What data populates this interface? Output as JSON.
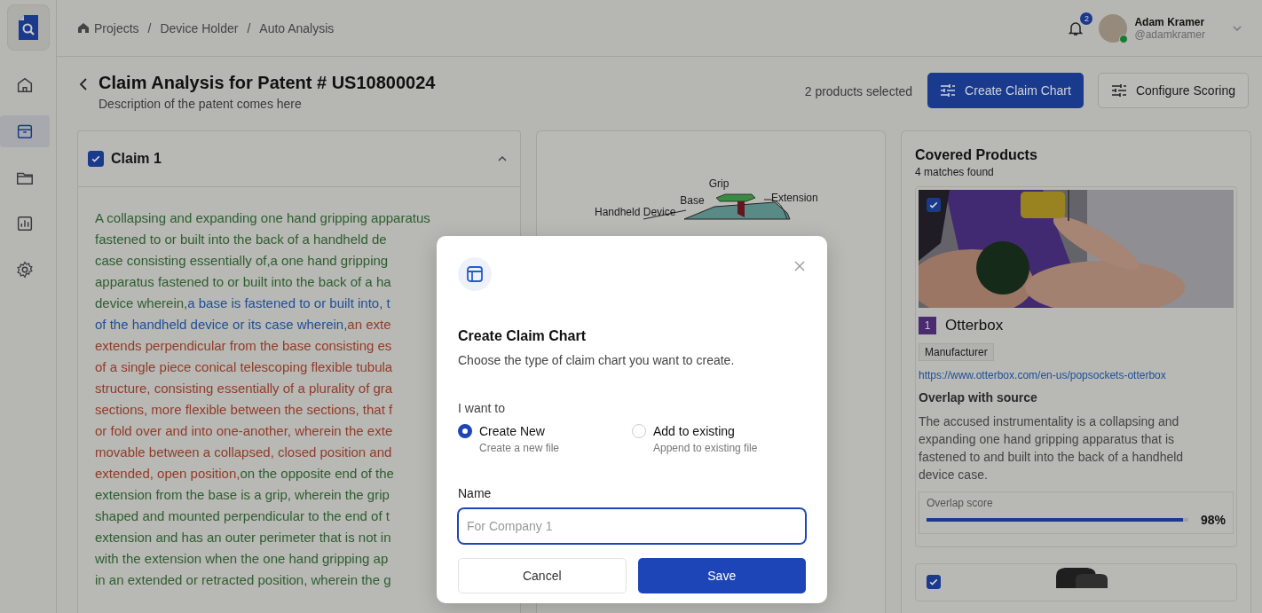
{
  "breadcrumbs": [
    {
      "label": "Projects",
      "kind": "home"
    },
    {
      "label": "Device Holder",
      "kind": "plain",
      "separator": "/"
    },
    {
      "label": "Auto Analysis",
      "kind": "plain",
      "separator": "/"
    }
  ],
  "notifications": {
    "count": "2"
  },
  "user": {
    "name": "Adam Kramer",
    "handle": "@adamkramer",
    "online": true
  },
  "sidebar": {
    "items": [
      {
        "kind": "home",
        "selected": false
      },
      {
        "kind": "archive",
        "selected": true
      },
      {
        "kind": "folder",
        "selected": false
      },
      {
        "kind": "chart",
        "selected": false
      },
      {
        "kind": "settings",
        "selected": false
      }
    ]
  },
  "page": {
    "title": "Claim Analysis for Patent # US10800024",
    "description": "Description of the patent comes here",
    "selection_count": "2 products selected",
    "buttons": [
      {
        "label": "Create Claim Chart",
        "kind": "primary"
      },
      {
        "label": "Configure Scoring",
        "kind": "secondary"
      }
    ]
  },
  "claim": {
    "title": "Claim 1",
    "checked": true,
    "expanded": true,
    "lines": [
      {
        "segments": [
          {
            "text": "A collapsing and expanding one hand gripping apparatus",
            "color": "#2d5e30"
          }
        ]
      },
      {
        "segments": [
          {
            "text": "fastened to or built into the back of a handheld de",
            "color": "#2d5e30"
          }
        ]
      },
      {
        "segments": [
          {
            "text": "case consisting essentially of,a one hand gripping",
            "color": "#2d5e30"
          }
        ]
      },
      {
        "segments": [
          {
            "text": "apparatus fastened to or built into the back of a ha",
            "color": "#2d5e30"
          }
        ]
      },
      {
        "segments": [
          {
            "text": "device wherein,",
            "color": "#2d5e30"
          },
          {
            "text": "a base is fastened to or built into, t",
            "color": "#1d4f9c"
          }
        ]
      },
      {
        "segments": [
          {
            "text": "of the handheld device or its case wherein,",
            "color": "#1d4f9c"
          },
          {
            "text": "an exte",
            "color": "#923b28"
          }
        ]
      },
      {
        "segments": [
          {
            "text": "extends perpendicular from the base consisting es",
            "color": "#923b28"
          }
        ]
      },
      {
        "segments": [
          {
            "text": "of a single piece conical telescoping flexible tubula",
            "color": "#923b28"
          }
        ]
      },
      {
        "segments": [
          {
            "text": "structure, consisting essentially of a plurality of gra",
            "color": "#923b28"
          }
        ]
      },
      {
        "segments": [
          {
            "text": "sections, more flexible between the sections, that f",
            "color": "#923b28"
          }
        ]
      },
      {
        "segments": [
          {
            "text": "or fold over and into one-another, wherein the exte",
            "color": "#923b28"
          }
        ]
      },
      {
        "segments": [
          {
            "text": "movable between a collapsed, closed position and",
            "color": "#923b28"
          }
        ]
      },
      {
        "segments": [
          {
            "text": "extended, open position,",
            "color": "#923b28"
          },
          {
            "text": "on the opposite end of the",
            "color": "#2d5e30"
          }
        ]
      },
      {
        "segments": [
          {
            "text": "extension from the base is a grip, wherein the grip",
            "color": "#2d5e30"
          }
        ]
      },
      {
        "segments": [
          {
            "text": "shaped and mounted perpendicular to the end of t",
            "color": "#2d5e30"
          }
        ]
      },
      {
        "segments": [
          {
            "text": "extension and has an outer perimeter that is not in",
            "color": "#2d5e30"
          }
        ]
      },
      {
        "segments": [
          {
            "text": "with the extension when the one hand gripping ap",
            "color": "#2d5e30"
          }
        ]
      },
      {
        "segments": [
          {
            "text": "in an extended or retracted position, wherein the g",
            "color": "#2d5e30"
          }
        ]
      }
    ]
  },
  "diagram": {
    "labels": [
      {
        "text": "Grip",
        "kind": "grip"
      },
      {
        "text": "Base",
        "kind": "base"
      },
      {
        "text": "Extension",
        "kind": "extension"
      },
      {
        "text": "Handheld Device",
        "kind": "device"
      }
    ]
  },
  "products": {
    "title": "Covered Products",
    "count": "4 matches found",
    "items": [
      {
        "checked": true,
        "kind": "full",
        "rank": "1",
        "color": "#4a2a70",
        "name": "Otterbox",
        "tag": "Manufacturer",
        "url": "https://www.otterbox.com/en-us/popsockets-otterbox",
        "overlap_title": "Overlap with source",
        "overlap_text": "The accused instrumentality is a collapsing and expanding one hand gripping apparatus that is fastened to and built into the back of a handheld device case.",
        "score_label": "Overlap score",
        "level": 0.98,
        "score": "98%"
      },
      {
        "checked": true,
        "kind": "partial"
      }
    ]
  },
  "dialog": {
    "title": "Create Claim Chart",
    "subtitle": "Choose the type of claim chart you want to create.",
    "prompt": "I want to",
    "options": [
      {
        "label": "Create New",
        "hint": "Create a new file",
        "selected": true
      },
      {
        "label": "Add to existing",
        "hint": "Append to existing file",
        "selected": false
      }
    ],
    "name_label": "Name",
    "name_placeholder": "For Company 1",
    "name_focused": true,
    "buttons": [
      {
        "label": "Cancel",
        "kind": "secondary"
      },
      {
        "label": "Save",
        "kind": "primary"
      }
    ]
  }
}
